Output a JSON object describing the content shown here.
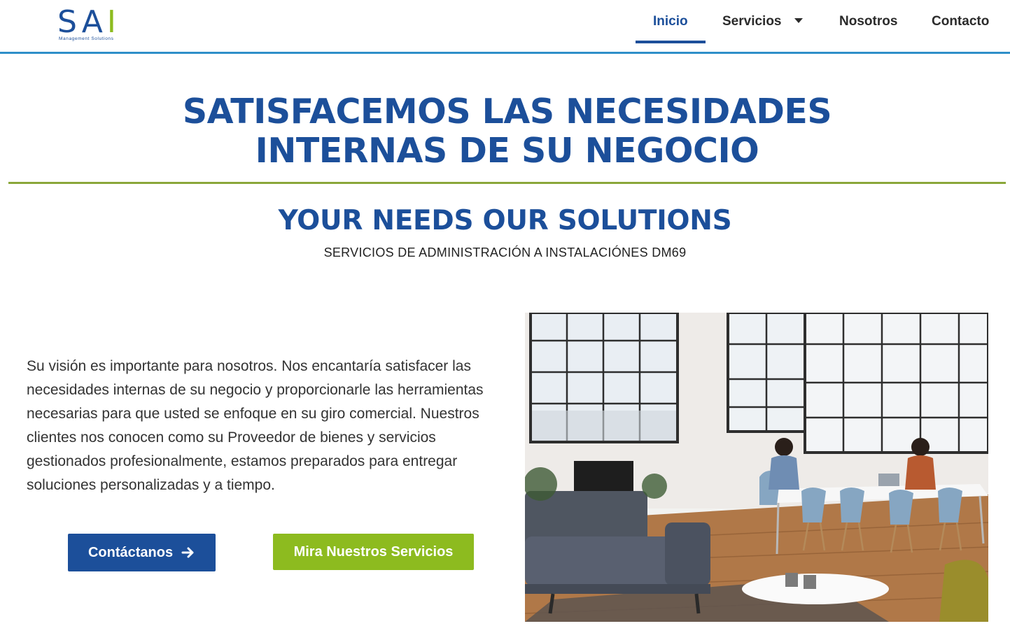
{
  "logo": {
    "letter_s": "S",
    "letter_a": "A",
    "letter_i": "I",
    "tagline": "Management Solutions"
  },
  "nav": {
    "items": [
      {
        "label": "Inicio"
      },
      {
        "label": "Servicios"
      },
      {
        "label": "Nosotros"
      },
      {
        "label": "Contacto"
      }
    ]
  },
  "hero": {
    "title_line1": "SATISFACEMOS LAS NECESIDADES",
    "title_line2": "INTERNAS DE SU NEGOCIO",
    "subtitle": "YOUR NEEDS OUR SOLUTIONS",
    "caption": "SERVICIOS DE ADMINISTRACIÓN A INSTALACIÓNES DM69"
  },
  "intro": {
    "text": "Su visión es importante para nosotros. Nos encantaría satisfacer las necesidades internas de su negocio y proporcionarle las herramientas necesarias para que usted se enfoque en su giro comercial. Nuestros clientes nos conocen como su Proveedor de bienes y servicios gestionados profesionalmente, estamos preparados para entregar soluciones personalizadas y a tiempo."
  },
  "buttons": {
    "contact_label": "Contáctanos",
    "services_label": "Mira Nuestros Servicios"
  },
  "colors": {
    "brand_blue": "#1c4f9a",
    "brand_green": "#8dbb1f",
    "header_line": "#2f8fc9",
    "rule_green": "#8aa73a"
  },
  "icons": {
    "arrow": "arrow-right-icon",
    "dropdown": "caret-down-icon"
  }
}
